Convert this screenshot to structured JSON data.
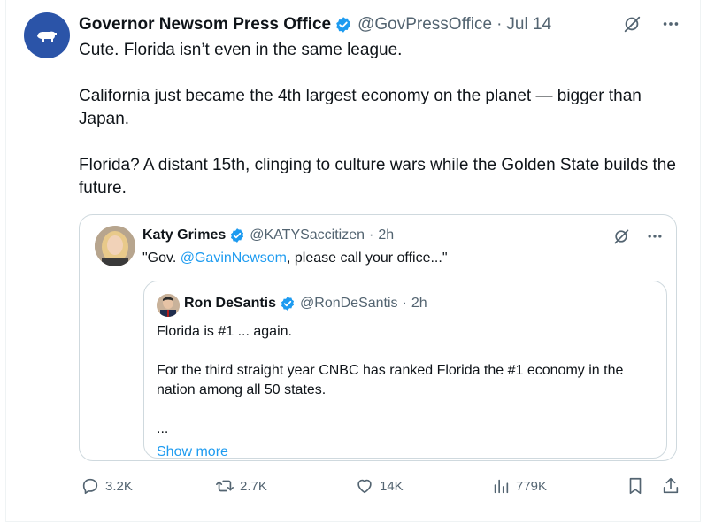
{
  "post": {
    "author_name": "Governor Newsom Press Office",
    "author_handle": "@GovPressOffice",
    "separator": "·",
    "timestamp": "Jul 14",
    "paragraphs": [
      "Cute. Florida isn’t even in the same league.",
      "California just became the 4th largest economy on the planet — bigger than Japan.",
      "Florida? A distant 15th, clinging to culture wars while the Golden State builds the future."
    ]
  },
  "quoted_post": {
    "author_name": "Katy Grimes",
    "author_handle": "@KATYSaccitizen",
    "separator": "·",
    "timestamp": "2h",
    "text_prefix": "\"Gov. ",
    "mention": "@GavinNewsom",
    "text_suffix": ", please call your office...\""
  },
  "nested_quote": {
    "author_name": "Ron DeSantis",
    "author_handle": "@RonDeSantis",
    "separator": "·",
    "timestamp": "2h",
    "paragraphs": [
      "Florida is #1 ... again.",
      "For the third straight year CNBC has ranked Florida the #1 economy in the nation among all 50 states.",
      "..."
    ],
    "show_more_label": "Show more"
  },
  "actions": {
    "replies": "3.2K",
    "reposts": "2.7K",
    "likes": "14K",
    "views": "779K"
  },
  "icons": {
    "verified": "verified-badge-icon",
    "grok": "grok-icon",
    "more": "more-icon",
    "reply": "reply-icon",
    "repost": "repost-icon",
    "like": "like-icon",
    "views": "views-icon",
    "bookmark": "bookmark-icon",
    "share": "share-icon"
  },
  "colors": {
    "verified_blue": "#1d9bf0",
    "link_blue": "#1d9bf0",
    "muted_text": "#536471",
    "avatar_blue": "#2b54a8"
  }
}
